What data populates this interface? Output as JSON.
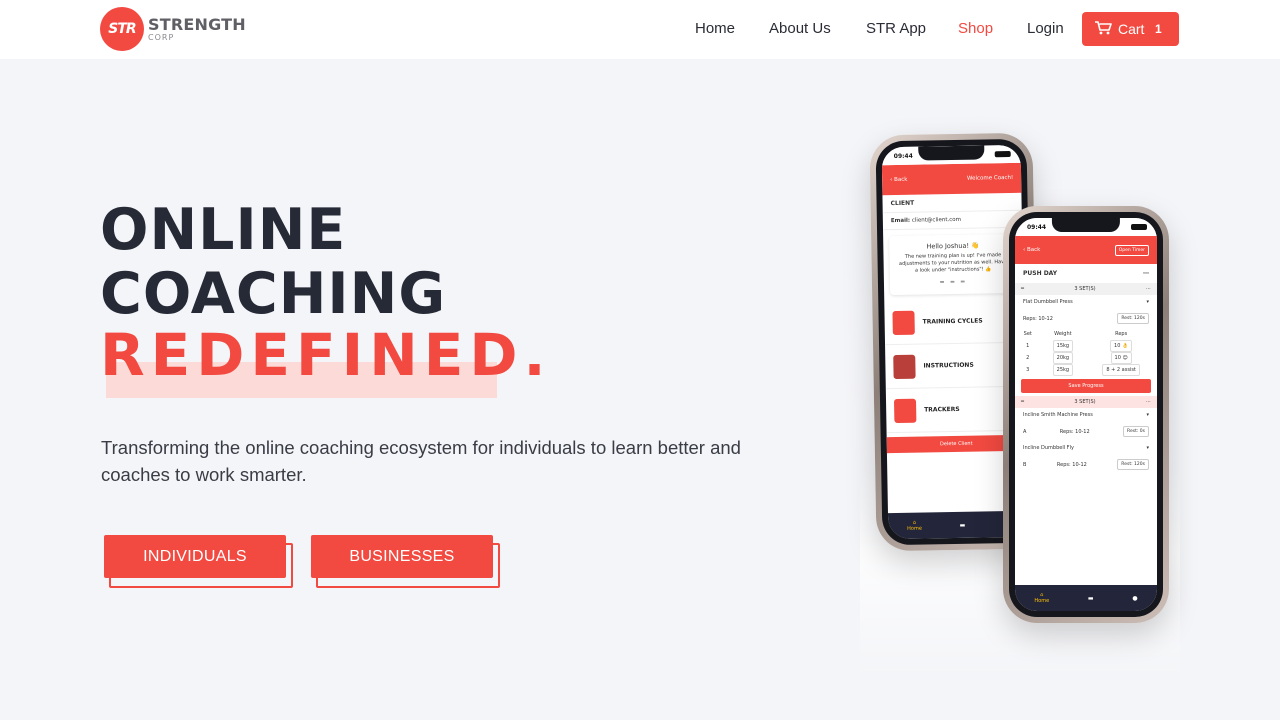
{
  "brand": {
    "badge": "STR",
    "name": "STRENGTH",
    "sub": "CORP"
  },
  "nav": {
    "items": [
      "Home",
      "About Us",
      "STR App",
      "Shop",
      "Login"
    ],
    "active": "Shop",
    "cart_label": "Cart",
    "cart_count": "1"
  },
  "hero": {
    "line1": "ONLINE",
    "line2": "COACHING",
    "accent": "REDEFINED.",
    "subtitle": "Transforming the online coaching ecosystem for individuals to learn better and coaches to work smarter.",
    "btn_individuals": "INDIVIDUALS",
    "btn_businesses": "BUSINESSES"
  },
  "phone1": {
    "time": "09:44",
    "back": "‹ Back",
    "header_right": "Welcome Coach!",
    "client_title": "CLIENT",
    "email_label": "Email:",
    "email_value": "client@client.com",
    "hello": "Hello Joshua! 👋",
    "message": "The new training plan is up! I've made adjustments to your nutrition as well. Have a look under \"instructions\"! 👍",
    "menu": [
      "TRAINING CYCLES",
      "INSTRUCTIONS",
      "TRACKERS"
    ],
    "delete": "Delete Client",
    "tab_home": "Home"
  },
  "phone2": {
    "time": "09:44",
    "back": "‹ Back",
    "open_timer": "Open Timer",
    "day": "PUSH DAY",
    "set_count": "3 SET(S)",
    "exercise": "Flat Dumbbell Press",
    "reps": "Reps: 10-12",
    "rest": "Rest: 120s",
    "col_set": "Set",
    "col_weight": "Weight",
    "col_reps": "Reps",
    "rows": [
      {
        "set": "1",
        "weight": "15kg",
        "reps": "10 👌"
      },
      {
        "set": "2",
        "weight": "20kg",
        "reps": "10 😊"
      },
      {
        "set": "3",
        "weight": "25kg",
        "reps": "8 + 2 assist"
      }
    ],
    "save": "Save Progress",
    "set_count_2": "3 SET(S)",
    "ex_a": "Incline Smith Machine Press",
    "ex_a_reps": "Reps: 10-12",
    "ex_a_rest": "Rest: 0s",
    "ex_b": "Incline Dumbbell Fly",
    "ex_b_reps": "Reps: 10-12",
    "ex_b_rest": "Rest: 120s",
    "letter_a": "A",
    "letter_b": "B",
    "tab_home": "Home"
  },
  "colors": {
    "accent": "#f24a41",
    "headline": "#262a36",
    "background": "#f4f5f8",
    "highlight": "#fcdad7"
  },
  "icons": [
    "cart-icon",
    "info-icon",
    "home-icon",
    "folder-icon",
    "user-icon",
    "more-icon"
  ]
}
